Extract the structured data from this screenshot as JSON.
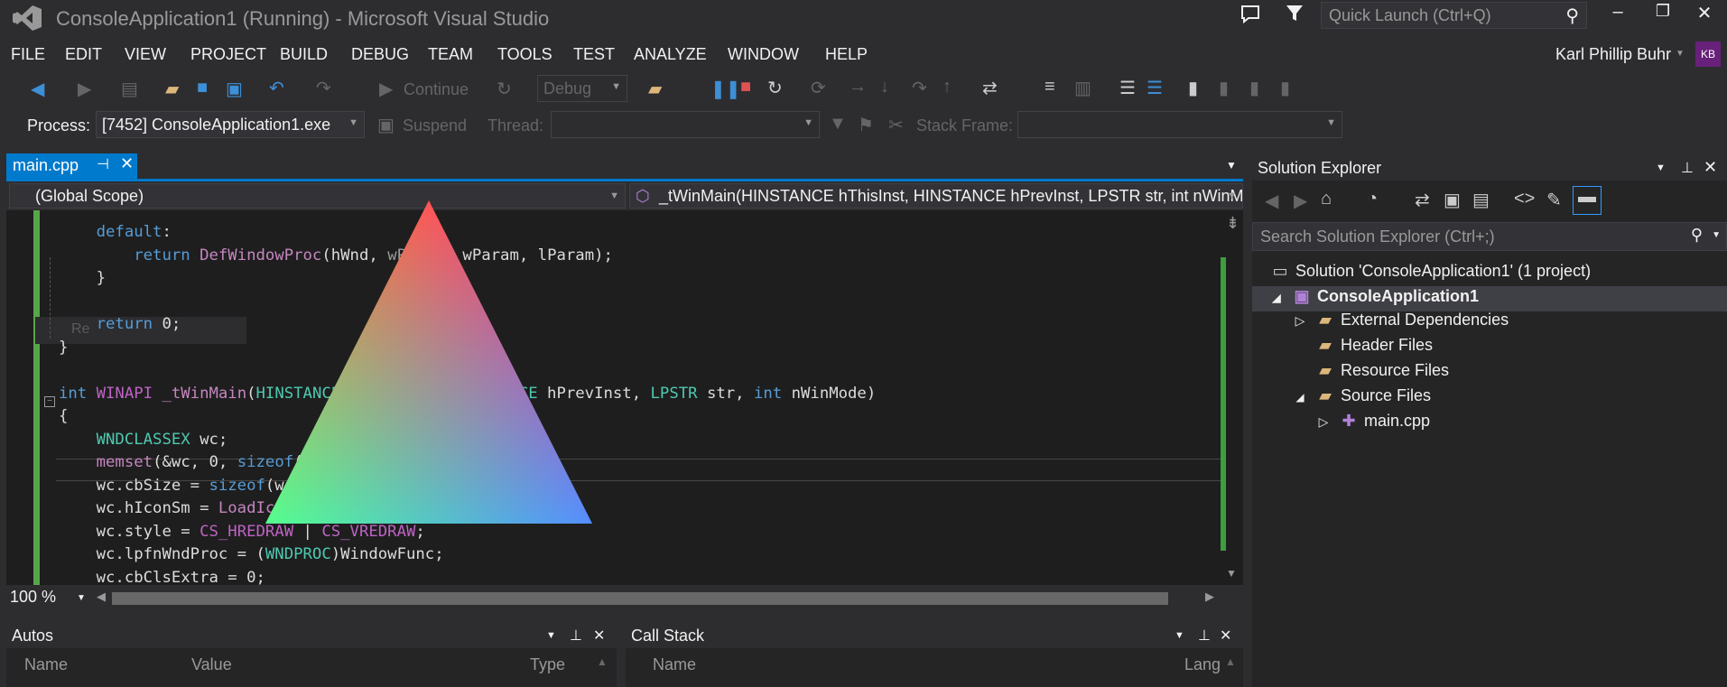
{
  "window": {
    "title": "ConsoleApplication1 (Running) - Microsoft Visual Studio",
    "quick_launch_placeholder": "Quick Launch (Ctrl+Q)"
  },
  "menu": [
    "FILE",
    "EDIT",
    "VIEW",
    "PROJECT",
    "BUILD",
    "DEBUG",
    "TEAM",
    "TOOLS",
    "TEST",
    "ANALYZE",
    "WINDOW",
    "HELP"
  ],
  "user": {
    "name": "Karl Phillip Buhr",
    "initials": "KB"
  },
  "toolbar": {
    "continue_label": "Continue",
    "config": "Debug"
  },
  "debug_location": {
    "process_label": "Process:",
    "process_value": "[7452] ConsoleApplication1.exe",
    "suspend_label": "Suspend",
    "thread_label": "Thread:",
    "thread_value": "",
    "stack_frame_label": "Stack Frame:",
    "stack_frame_value": ""
  },
  "editor": {
    "tab_name": "main.cpp",
    "scope": "(Global Scope)",
    "function": "_tWinMain(HINSTANCE hThisInst, HINSTANCE hPrevInst, LPSTR str, int nWinMode)",
    "zoom": "100 %",
    "tooltip": "Re"
  },
  "autos": {
    "title": "Autos",
    "columns": [
      "Name",
      "Value",
      "Type"
    ]
  },
  "call_stack": {
    "title": "Call Stack",
    "columns": [
      "Name",
      "Lang"
    ]
  },
  "solution_explorer": {
    "title": "Solution Explorer",
    "search_placeholder": "Search Solution Explorer (Ctrl+;)",
    "nodes": [
      "Solution 'ConsoleApplication1' (1 project)",
      "ConsoleApplication1",
      "External Dependencies",
      "Header Files",
      "Resource Files",
      "Source Files",
      "main.cpp"
    ]
  },
  "overlay": {
    "colors": {
      "top": "#ff0000",
      "left": "#00ff00",
      "right": "#0000ff"
    }
  }
}
